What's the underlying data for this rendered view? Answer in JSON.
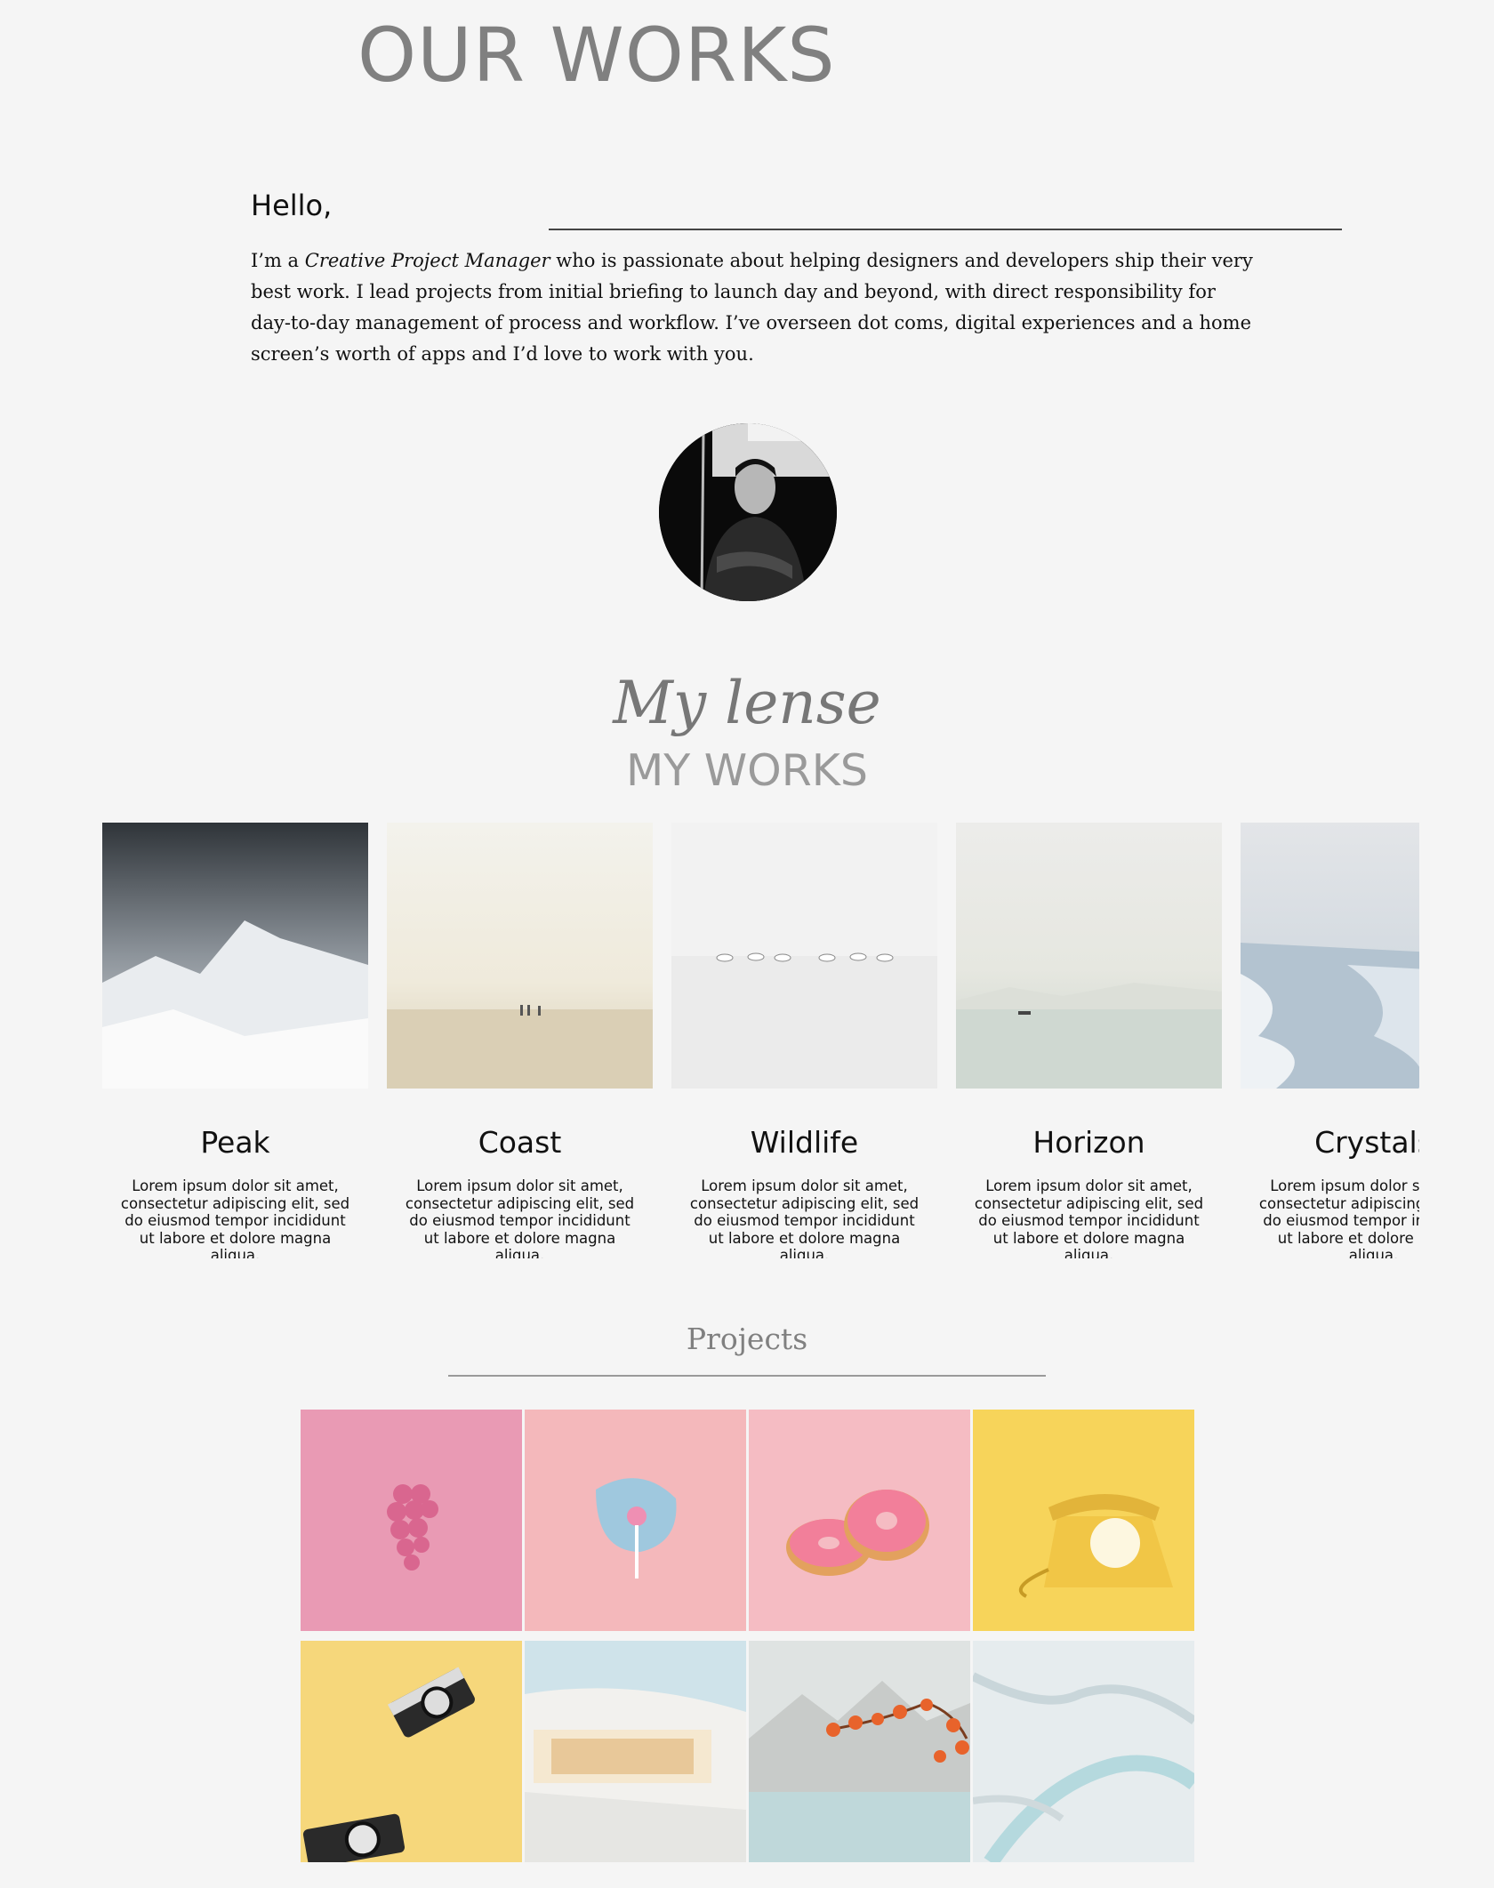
{
  "page": {
    "title": "OUR WORKS"
  },
  "about": {
    "greeting": "Hello,",
    "intro_prefix": "I’m a ",
    "intro_role": "Creative Project Manager",
    "intro_body": " who is passionate about helping designers and developers ship their very best work. I lead projects from initial briefing to launch day and beyond, with direct responsibility for day-to-day management of process and workflow. I’ve overseen dot coms, digital experiences and a home screen’s worth of apps and I’d love to work with you."
  },
  "lens": {
    "script_heading": "My lense",
    "heading": "MY WORKS"
  },
  "works": [
    {
      "title": "Peak",
      "text": "Lorem ipsum dolor sit amet, consectetur adipiscing elit, sed do eiusmod tempor incididunt ut labore et dolore magna aliqua.",
      "image": "snowy-mountain-photo"
    },
    {
      "title": "Coast",
      "text": "Lorem ipsum dolor sit amet, consectetur adipiscing elit, sed do eiusmod tempor incididunt ut labore et dolore magna aliqua.",
      "image": "beach-people-photo"
    },
    {
      "title": "Wildlife",
      "text": "Lorem ipsum dolor sit amet, consectetur adipiscing elit, sed do eiusmod tempor incididunt ut labore et dolore magna aliqua.",
      "image": "swans-on-ice-photo"
    },
    {
      "title": "Horizon",
      "text": "Lorem ipsum dolor sit amet, consectetur adipiscing elit, sed do eiusmod tempor incididunt ut labore et dolore magna aliqua.",
      "image": "sea-boat-photo"
    },
    {
      "title": "Crystals",
      "text": "Lorem ipsum dolor sit amet, consectetur adipiscing elit, sed do eiusmod tempor incididunt ut labore et dolore magna aliqua.",
      "image": "frozen-shore-photo"
    }
  ],
  "projects": {
    "heading": "Projects",
    "tiles": [
      {
        "image": "pink-grapes-photo",
        "bg": "#e99ab4"
      },
      {
        "image": "lollipop-plate-photo",
        "bg": "#f4b8bb"
      },
      {
        "image": "donuts-photo",
        "bg": "#f5bcc3"
      },
      {
        "image": "yellow-telephone-photo",
        "bg": "#f7d45a"
      },
      {
        "image": "falling-cameras-photo",
        "bg": "#f6d77b"
      },
      {
        "image": "white-architecture-photo",
        "bg": "#cfe3ea"
      },
      {
        "image": "orange-berries-mountains-photo",
        "bg": "#dfe3e2"
      },
      {
        "image": "glacier-aerial-photo",
        "bg": "#e6ecee"
      }
    ]
  }
}
